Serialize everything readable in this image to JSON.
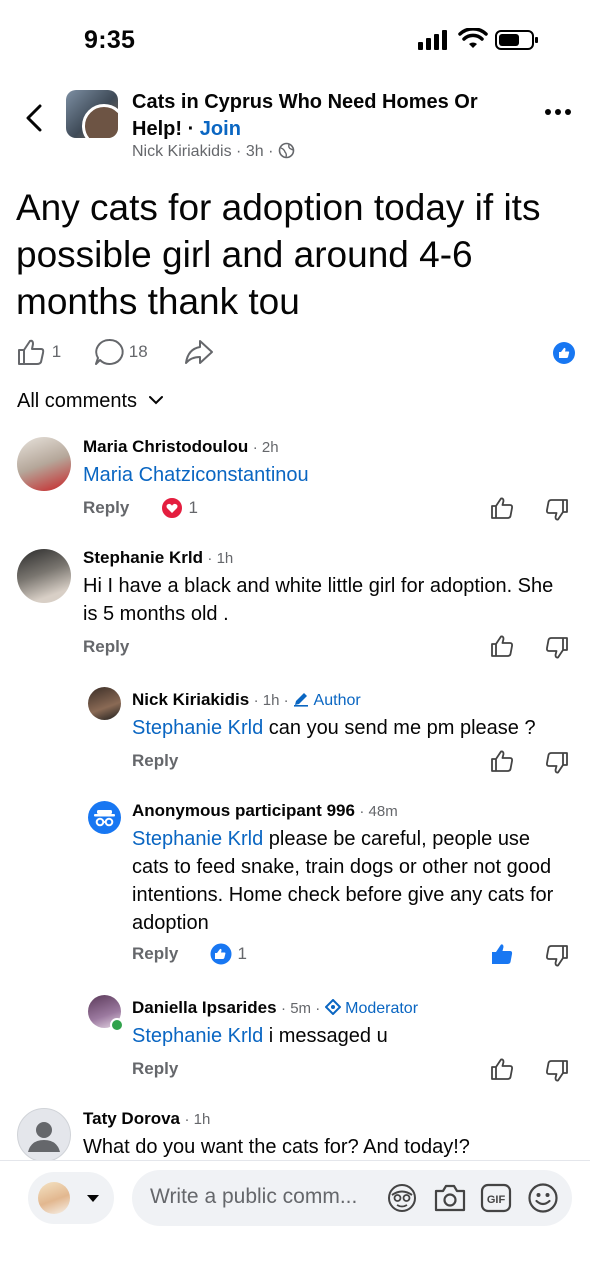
{
  "status_bar": {
    "time": "9:35"
  },
  "header": {
    "group_name": "Cats in Cyprus Who Need Homes Or Help!",
    "join_separator": "·",
    "join_label": "Join",
    "author": "Nick Kiriakidis",
    "time": "3h",
    "meta_separator": "·"
  },
  "post": {
    "text": "Any cats for adoption today if its possible girl and around 4-6 months thank tou",
    "like_count": "1",
    "comment_count": "18"
  },
  "comments_filter": {
    "label": "All comments"
  },
  "comments": [
    {
      "name": "Maria Christodoulou",
      "time": "· 2h",
      "mention": "Maria Chatziconstantinou",
      "text": "",
      "reply": "Reply",
      "reaction_count": "1"
    },
    {
      "name": "Stephanie Krld",
      "time": "· 1h",
      "text": "Hi I have a black and white little girl for adoption. She is 5 months old .",
      "reply": "Reply"
    },
    {
      "name": "Nick Kiriakidis",
      "time": "· 1h ·",
      "badge": "Author",
      "mention": "Stephanie Krld",
      "text": " can you send me pm please ?",
      "reply": "Reply"
    },
    {
      "name": "Anonymous participant 996",
      "time": "· 48m",
      "mention": "Stephanie Krld",
      "text": " please be careful, people use cats to feed snake, train dogs or other not good intentions. Home check before give any cats for adoption",
      "reply": "Reply",
      "reaction_count": "1"
    },
    {
      "name": "Daniella Ipsarides",
      "time": "· 5m ·",
      "badge": "Moderator",
      "mention": "Stephanie Krld",
      "text": " i messaged u",
      "reply": "Reply"
    },
    {
      "name": "Taty Dorova",
      "time": "· 1h",
      "text": "What do you want the cats for? And today!?"
    }
  ],
  "composer": {
    "placeholder": "Write a public comm..."
  },
  "colors": {
    "link": "#0a66c2",
    "like_blue": "#1877f2",
    "muted": "#65676b",
    "reaction_red": "#e41e3f"
  },
  "icons": [
    "back-icon",
    "more-icon",
    "like-icon",
    "comment-icon",
    "share-icon",
    "chevron-down-icon",
    "dislike-icon",
    "heart-reaction-icon",
    "pencil-icon",
    "moderator-icon",
    "anonymous-icon",
    "avatar-emoji-icon",
    "camera-icon",
    "gif-icon",
    "emoji-icon"
  ]
}
